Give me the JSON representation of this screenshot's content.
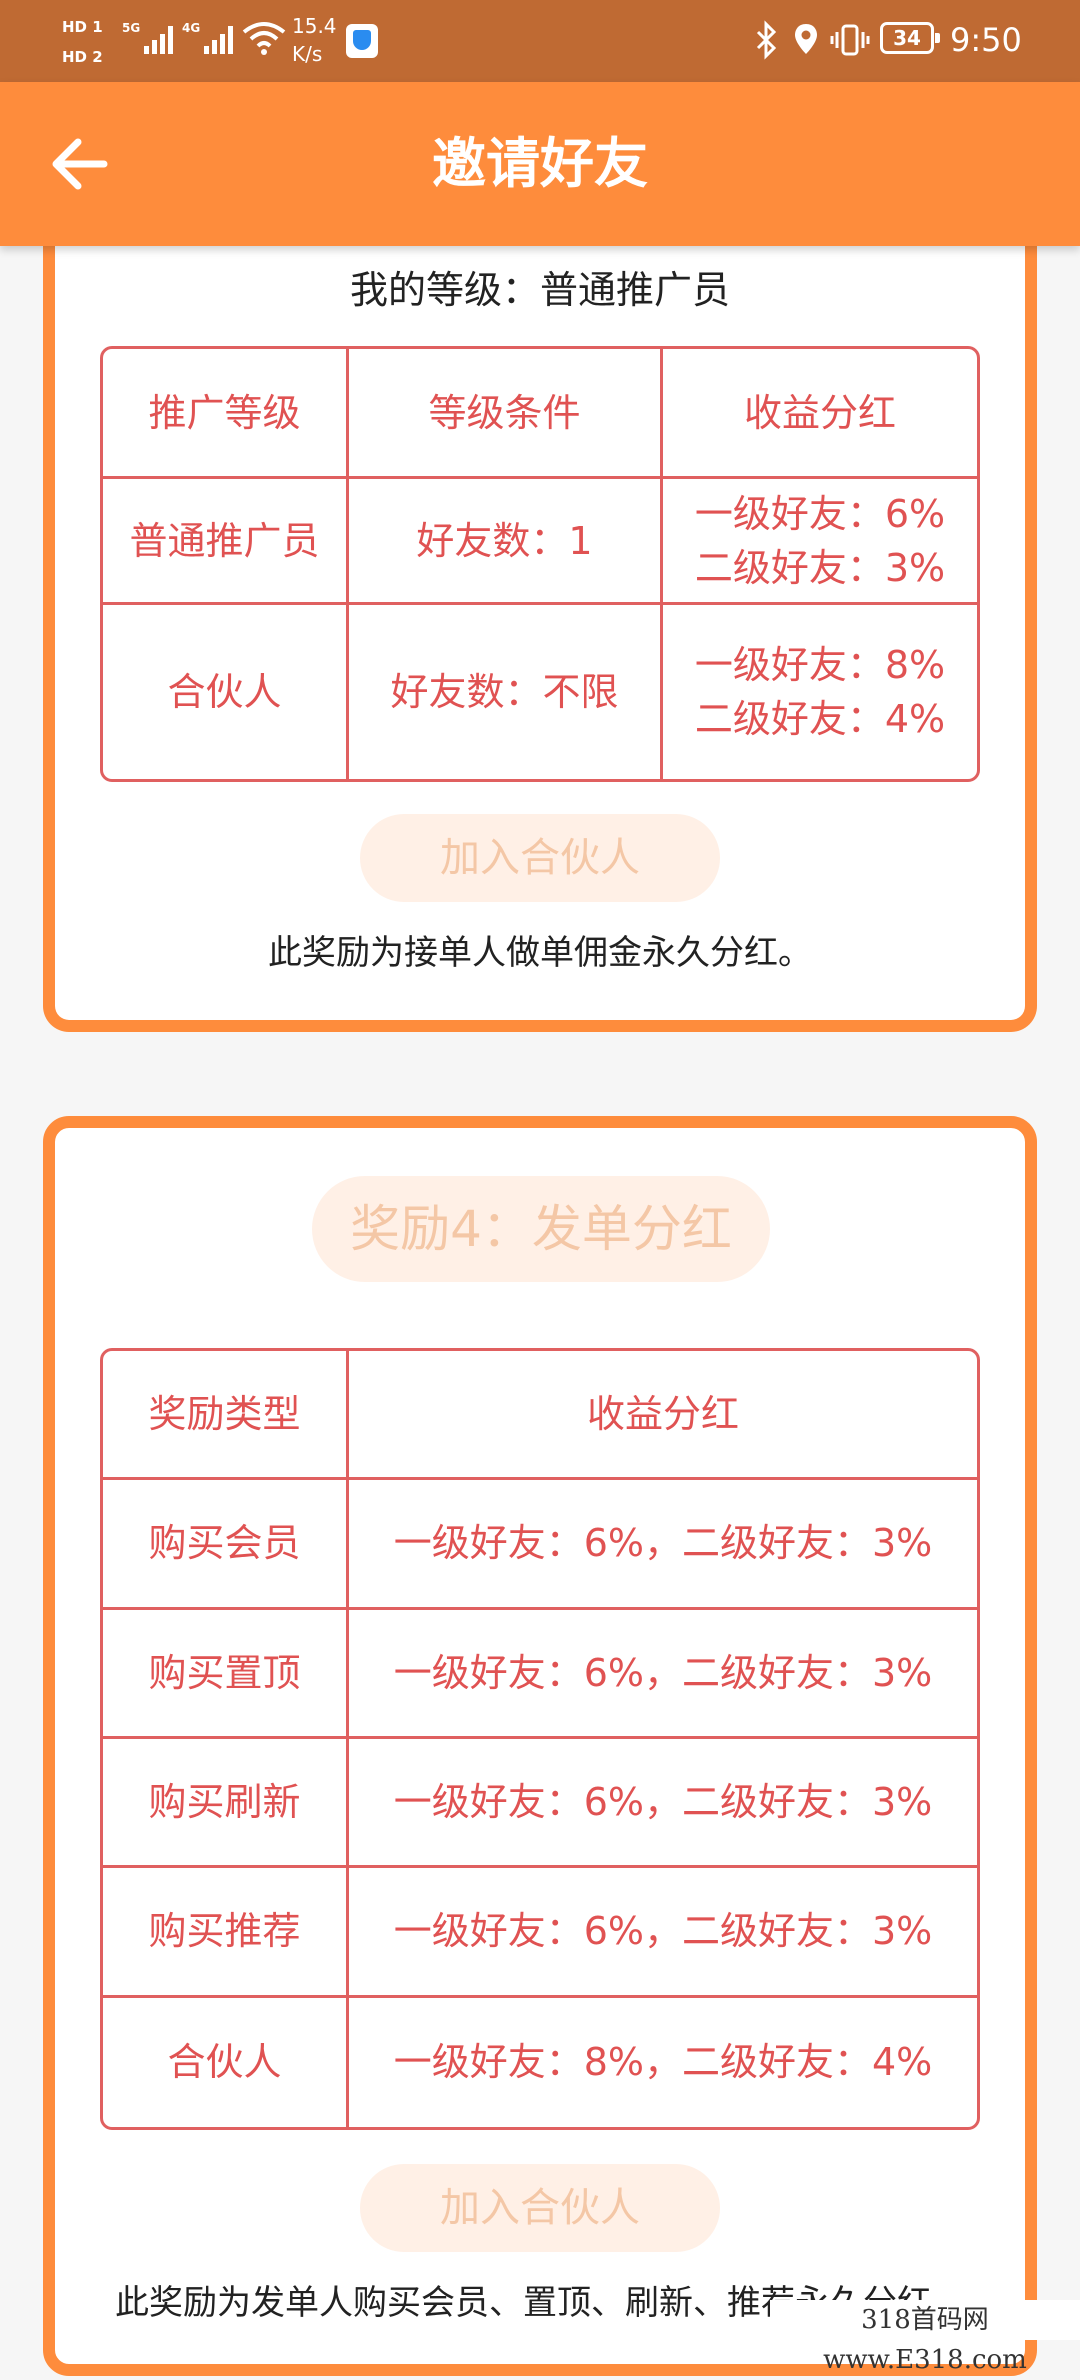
{
  "status_bar": {
    "hd1": "HD 1",
    "hd2": "HD 2",
    "net1": "5G",
    "net2": "4G",
    "speed_value": "15.4",
    "speed_unit": "K/s",
    "battery": "34",
    "time": "9:50"
  },
  "header": {
    "title": "邀请好友"
  },
  "level_card": {
    "my_level": "我的等级：普通推广员",
    "table": {
      "headers": [
        "推广等级",
        "等级条件",
        "收益分红"
      ],
      "rows": [
        {
          "level": "普通推广员",
          "condition": "好友数：1",
          "dividend_1": "一级好友：6%",
          "dividend_2": "二级好友：3%"
        },
        {
          "level": "合伙人",
          "condition": "好友数：不限",
          "dividend_1": "一级好友：8%",
          "dividend_2": "二级好友：4%"
        }
      ]
    },
    "join_button": "加入合伙人",
    "note": "此奖励为接单人做单佣金永久分红。"
  },
  "reward4_card": {
    "title": "奖励4：发单分红",
    "table": {
      "headers": [
        "奖励类型",
        "收益分红"
      ],
      "rows": [
        {
          "type": "购买会员",
          "dividend": "一级好友：6%，二级好友：3%"
        },
        {
          "type": "购买置顶",
          "dividend": "一级好友：6%，二级好友：3%"
        },
        {
          "type": "购买刷新",
          "dividend": "一级好友：6%，二级好友：3%"
        },
        {
          "type": "购买推荐",
          "dividend": "一级好友：6%，二级好友：3%"
        },
        {
          "type": "合伙人",
          "dividend": "一级好友：8%，二级好友：4%"
        }
      ]
    },
    "join_button": "加入合伙人",
    "note": "此奖励为发单人购买会员、置顶、刷新、推荐永久分红。"
  },
  "watermark": "318首码网 www.E318.com",
  "colors": {
    "accent": "#fe8c3c",
    "status_bar": "#bf6a33",
    "table_text": "#e05252",
    "pill_bg": "#fff0e6",
    "pill_text": "#f4c7a6"
  }
}
